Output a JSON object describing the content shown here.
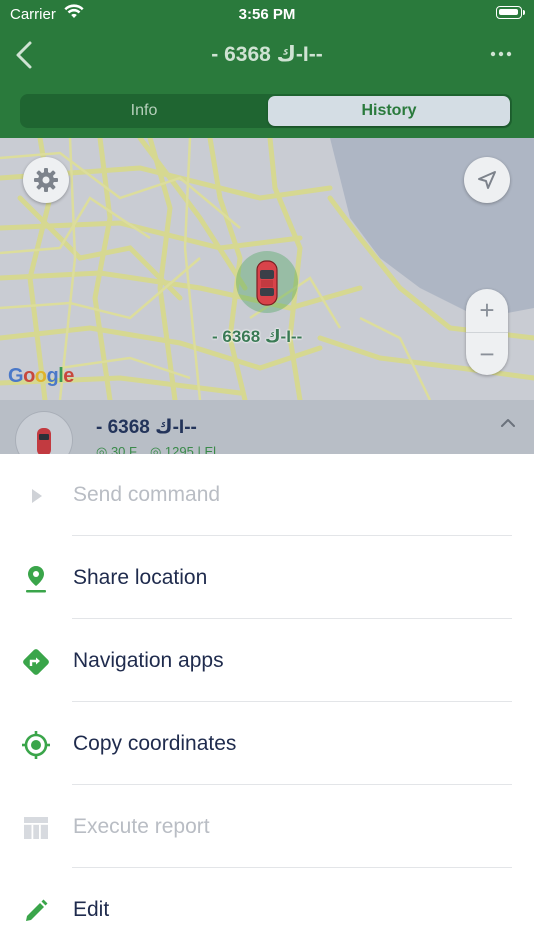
{
  "status_bar": {
    "carrier": "Carrier",
    "time": "3:56 PM"
  },
  "nav": {
    "title": "- ك 6368-I--"
  },
  "segmented": {
    "tabs": [
      {
        "label": "Info",
        "selected": false
      },
      {
        "label": "History",
        "selected": true
      }
    ]
  },
  "map": {
    "vehicle_label": "- ك 6368-I--",
    "zoom_in": "+",
    "zoom_out": "−",
    "attribution": [
      "G",
      "o",
      "o",
      "g",
      "l",
      "e"
    ]
  },
  "card": {
    "name": "- ك 6368-I--",
    "subtitle": "◎ 30 F... ◎ 1295 | El..."
  },
  "actions": [
    {
      "label": "Send command",
      "icon": "play-icon",
      "enabled": false
    },
    {
      "label": "Share location",
      "icon": "pin-icon",
      "enabled": true
    },
    {
      "label": "Navigation apps",
      "icon": "direction-icon",
      "enabled": true
    },
    {
      "label": "Copy coordinates",
      "icon": "crosshair-icon",
      "enabled": true
    },
    {
      "label": "Execute report",
      "icon": "table-icon",
      "enabled": false
    },
    {
      "label": "Edit",
      "icon": "pencil-icon",
      "enabled": true
    }
  ],
  "colors": {
    "header_green": "#2a7a3c",
    "accent_green": "#3aa54a",
    "text_primary": "#1f2b4d",
    "text_disabled": "#b9bdc4"
  }
}
